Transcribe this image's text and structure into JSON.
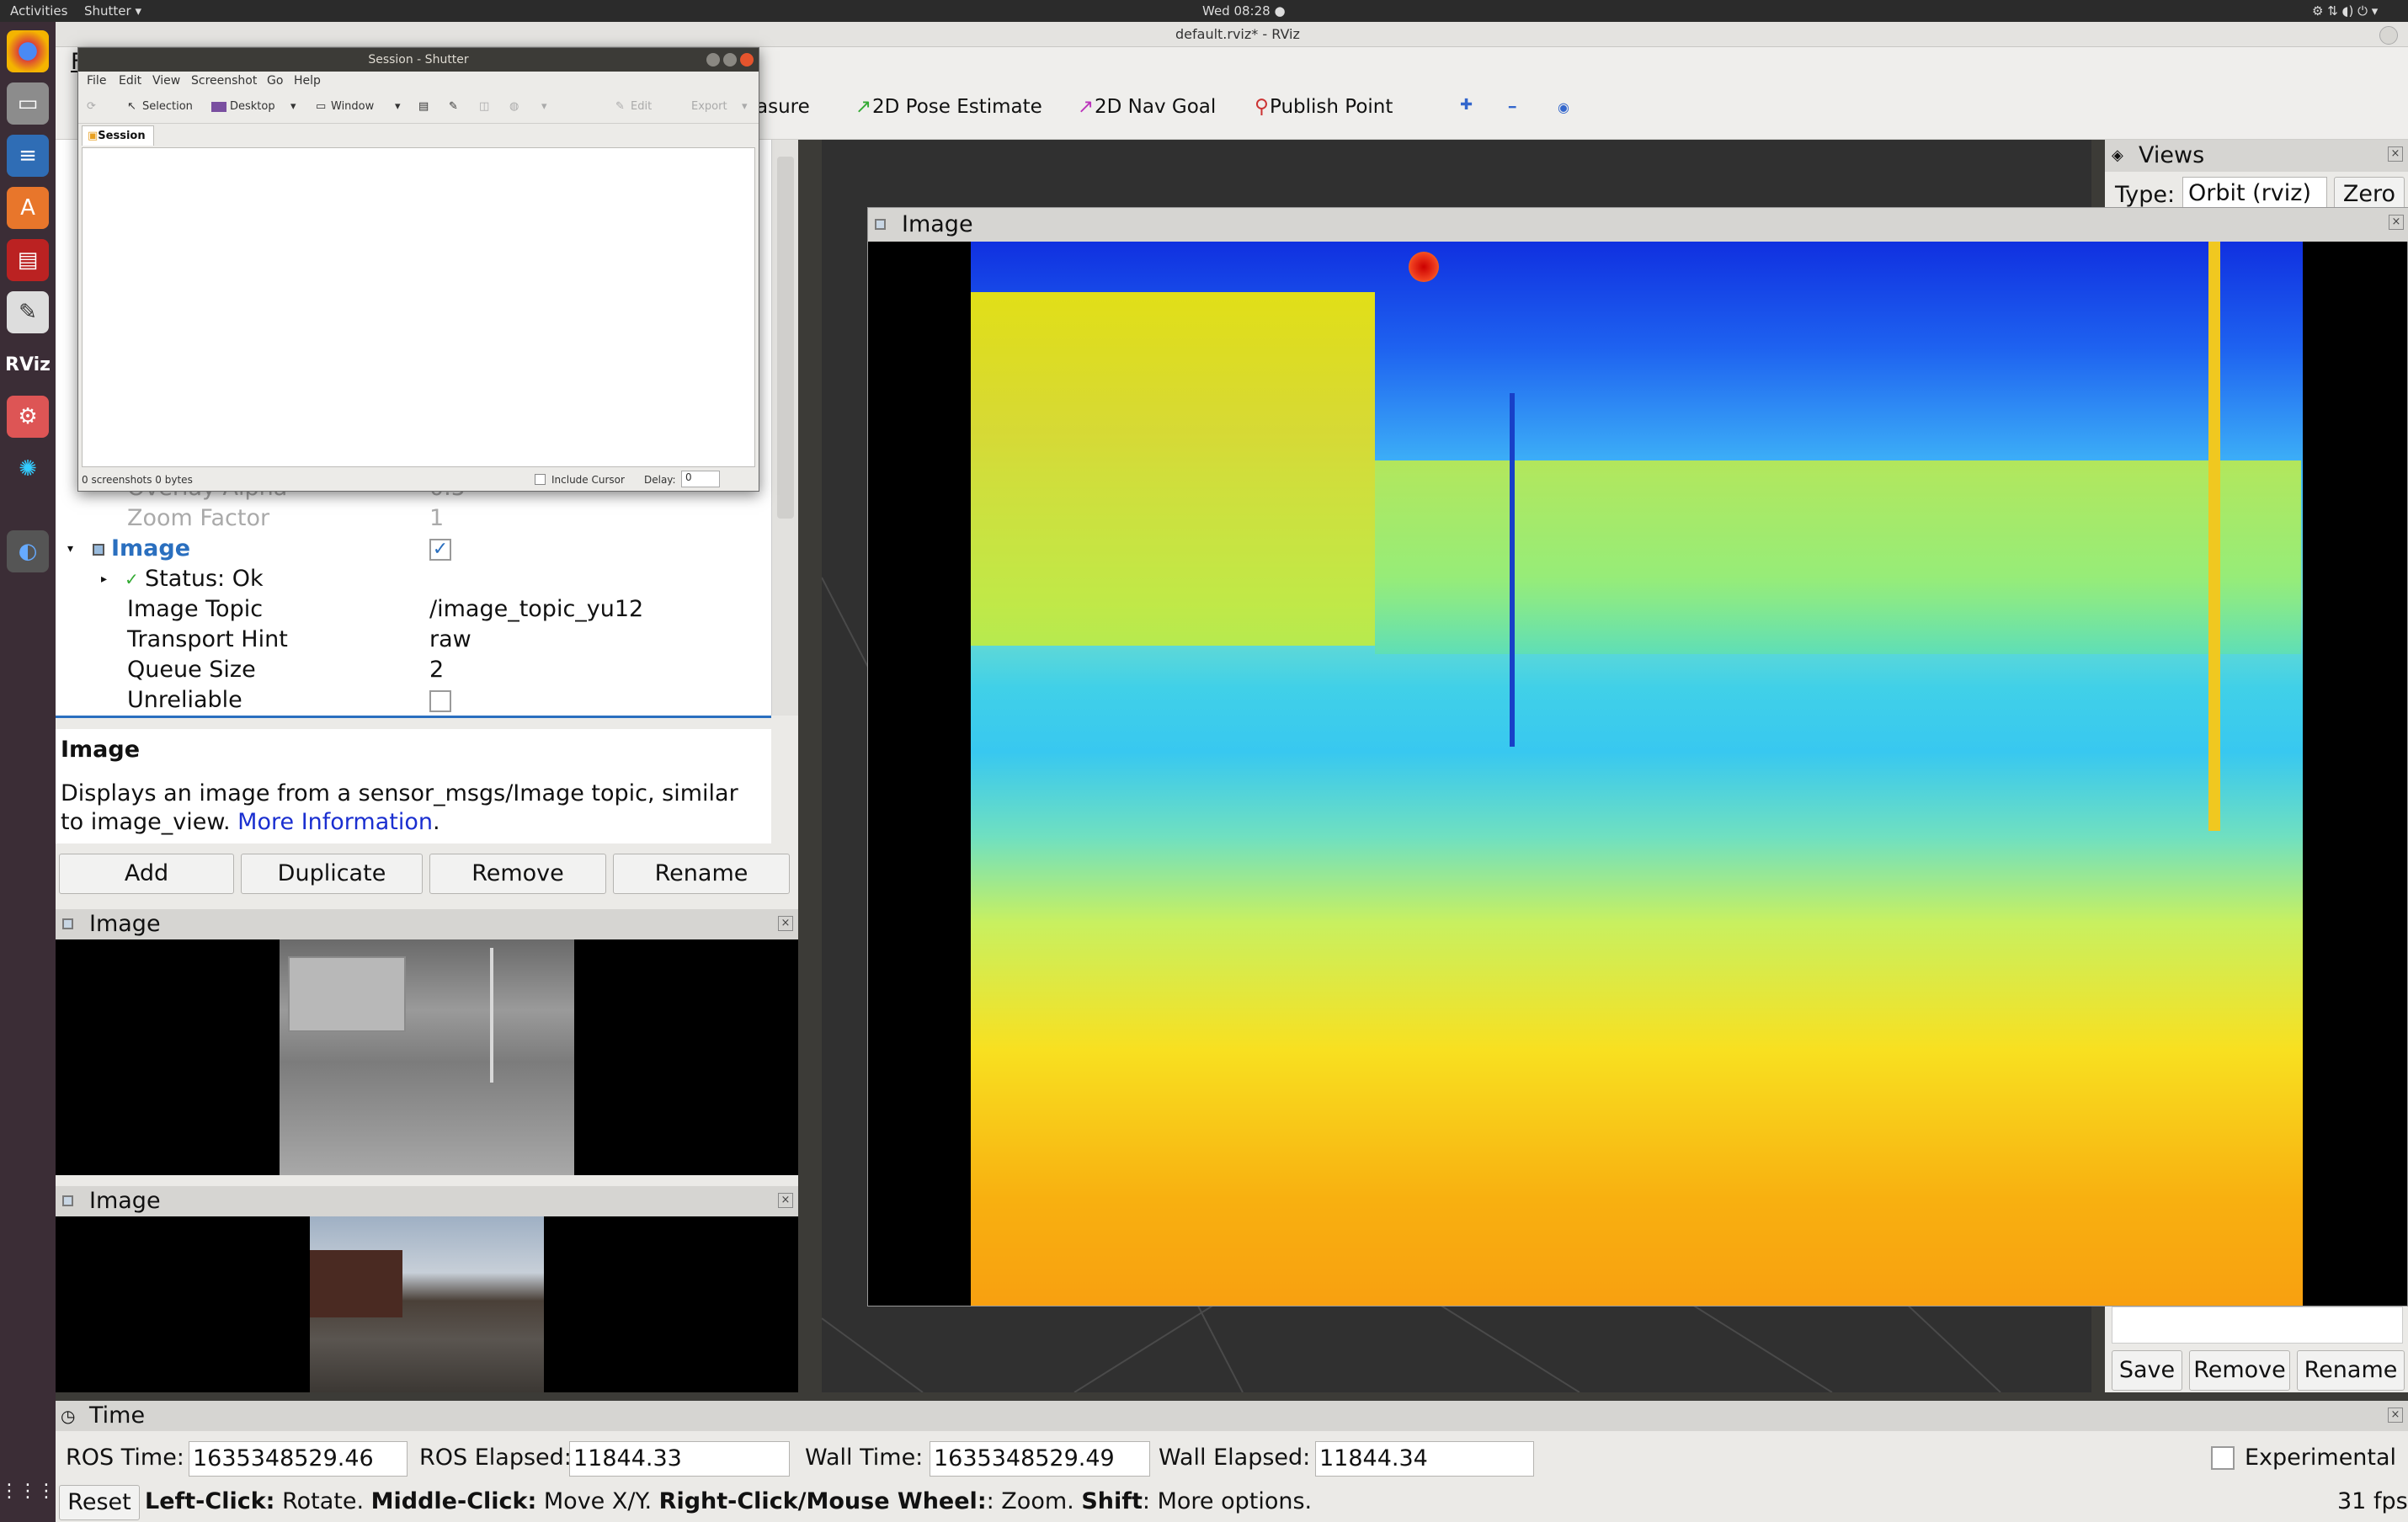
{
  "topbar": {
    "activities": "Activities",
    "app": "Shutter ▾",
    "clock": "Wed 08:28 ●",
    "system_icons": "⚙ ⇅ ◖) ⏻ ▾"
  },
  "dock": {
    "icons": [
      "chrome-icon",
      "files-icon",
      "writer-icon",
      "software-center-icon",
      "system-monitor-icon",
      "text-editor-icon",
      "rviz-icon",
      "settings-icon",
      "network-icon",
      "shutter-icon"
    ],
    "apps_grid": "⋮⋮⋮"
  },
  "rviz": {
    "title": "default.rviz* - RViz",
    "menu_first": "F",
    "toolbar": {
      "measure": "asure",
      "pose": "2D Pose Estimate",
      "nav": "2D Nav Goal",
      "publish": "Publish Point",
      "plus": "✚",
      "minus": "━",
      "eye": "◉"
    },
    "displays_tree": {
      "overlay_alpha_label": "Overlay Alpha",
      "overlay_alpha_value": "0.5",
      "zoom_label": "Zoom Factor",
      "zoom_value": "1",
      "image_label": "Image",
      "status_label": "Status: Ok",
      "topic_label": "Image Topic",
      "topic_value": "/image_topic_yu12",
      "hint_label": "Transport Hint",
      "hint_value": "raw",
      "queue_label": "Queue Size",
      "queue_value": "2",
      "unreliable_label": "Unreliable"
    },
    "description": {
      "title": "Image",
      "text": "Displays an image from a sensor_msgs/Image topic, similar to image_view.",
      "link": "More Information",
      "period": "."
    },
    "buttons": {
      "add": "Add",
      "duplicate": "Duplicate",
      "remove": "Remove",
      "rename": "Rename"
    },
    "image_panel_1": "Image",
    "image_panel_2": "Image",
    "views": {
      "title": "Views",
      "type_label": "Type:",
      "type_value": "Orbit (rviz)",
      "zero": "Zero",
      "save": "Save",
      "remove": "Remove",
      "rename": "Rename"
    },
    "main_image": {
      "title": "Image"
    },
    "time": {
      "title": "Time",
      "ros_time_label": "ROS Time:",
      "ros_time": "1635348529.46",
      "ros_elapsed_label": "ROS Elapsed:",
      "ros_elapsed": "11844.33",
      "wall_time_label": "Wall Time:",
      "wall_time": "1635348529.49",
      "wall_elapsed_label": "Wall Elapsed:",
      "wall_elapsed": "11844.34",
      "experimental": "Experimental"
    },
    "status_bar": {
      "reset": "Reset",
      "hint_lc": "Left-Click:",
      "hint_lc_t": "Rotate.",
      "hint_mc": "Middle-Click:",
      "hint_mc_t": "Move X/Y.",
      "hint_rc": "Right-Click/Mouse Wheel:",
      "hint_rc_t": ": Zoom.",
      "hint_sh": "Shift",
      "hint_sh_t": ": More options.",
      "fps": "31 fps"
    }
  },
  "shutter": {
    "title": "Session - Shutter",
    "menu": [
      "File",
      "Edit",
      "View",
      "Screenshot",
      "Go",
      "Help"
    ],
    "tools": {
      "selection": "Selection",
      "desktop": "Desktop",
      "window": "Window",
      "edit": "Edit",
      "export": "Export"
    },
    "tab": "Session",
    "status": "0 screenshots  0 bytes",
    "include_cursor": "Include Cursor",
    "delay_label": "Delay:",
    "delay_value": "0"
  },
  "colors": {
    "dock": "#3b2d36",
    "topbar": "#2b2b2b",
    "viewport": "#303030",
    "link": "#1a2fd0",
    "accent": "#2a6fbf"
  }
}
